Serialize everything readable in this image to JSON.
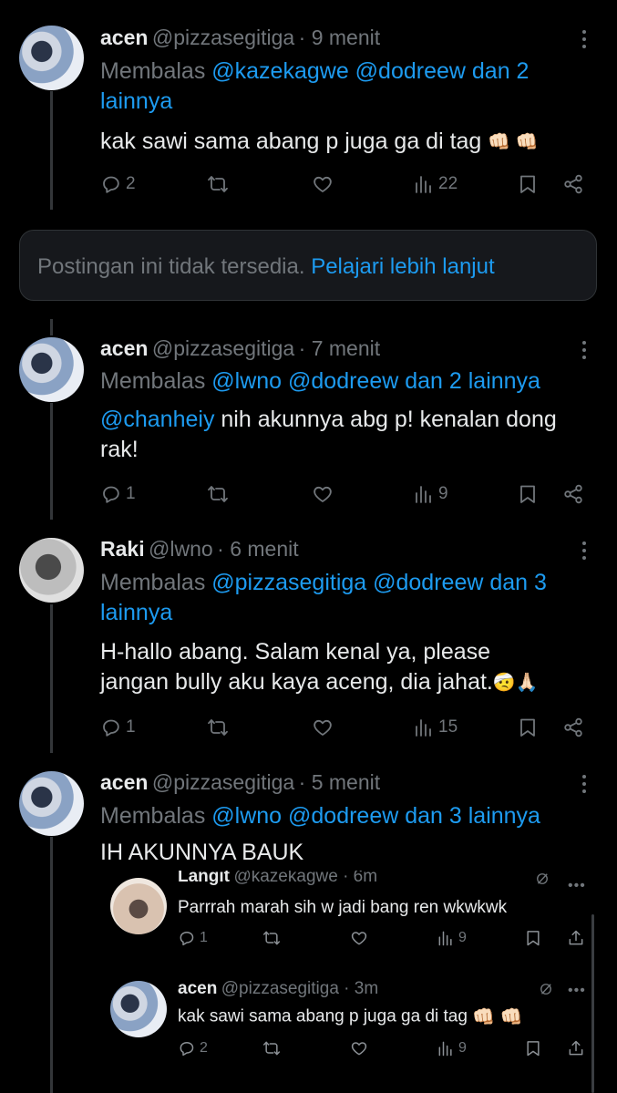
{
  "tweets": [
    {
      "name": "acen",
      "handle": "@pizzasegitiga",
      "time": "· 9 menit",
      "reply_prefix": "Membalas ",
      "reply_mentions_line1": "@kazekagwe @dodreew dan 2",
      "reply_mentions_line2": "lainnya",
      "text": "kak sawi sama abang p juga ga di tag",
      "emoji": "👊🏻 👊🏻",
      "replies": "2",
      "views": "22"
    },
    {
      "name": "acen",
      "handle": "@pizzasegitiga",
      "time": "· 7 menit",
      "reply_prefix": "Membalas ",
      "reply_mentions_line1": "@lwno @dodreew dan 2 lainnya",
      "text_mention": "@chanheiy",
      "text_line1": " nih akunnya abg p! kenalan dong",
      "text_line2": "rak!",
      "replies": "1",
      "views": "9"
    },
    {
      "name": "Raki",
      "handle": "@lwno",
      "time": "· 6 menit",
      "reply_prefix": "Membalas ",
      "reply_mentions_line1": "@pizzasegitiga @dodreew dan 3",
      "reply_mentions_line2": "lainnya",
      "text_line1": "H-hallo abang. Salam kenal ya, please",
      "text_line2": "jangan bully aku kaya aceng, dia jahat.",
      "emoji": "🤕🙏🏻",
      "replies": "1",
      "views": "15"
    },
    {
      "name": "acen",
      "handle": "@pizzasegitiga",
      "time": "· 5 menit",
      "reply_prefix": "Membalas ",
      "reply_mentions_line1": "@lwno @dodreew dan 3 lainnya",
      "text": "IH AKUNNYA BAUK"
    }
  ],
  "unavailable": {
    "text": "Postingan ini tidak tersedia. ",
    "link": "Pelajari lebih lanjut"
  },
  "embedded": [
    {
      "name": "Langit",
      "handle": "@kazekagwe · 6m",
      "text": "Parrrah marah sih w jadi bang ren wkwkwk",
      "replies": "1",
      "views": "9"
    },
    {
      "name": "acen",
      "handle": "@pizzasegitiga · 3m",
      "text": "kak sawi sama abang p juga ga di tag",
      "emoji": "👊🏻 👊🏻",
      "replies": "2",
      "views": "9"
    }
  ],
  "icons": [
    "reply-icon",
    "retweet-icon",
    "like-icon",
    "views-icon",
    "bookmark-icon",
    "share-icon",
    "more-icon",
    "grok-icon",
    "upload-icon"
  ],
  "colors": {
    "background": "#000000",
    "accent": "#1d9bf0",
    "muted": "#71767b",
    "text": "#e7e9ea"
  }
}
